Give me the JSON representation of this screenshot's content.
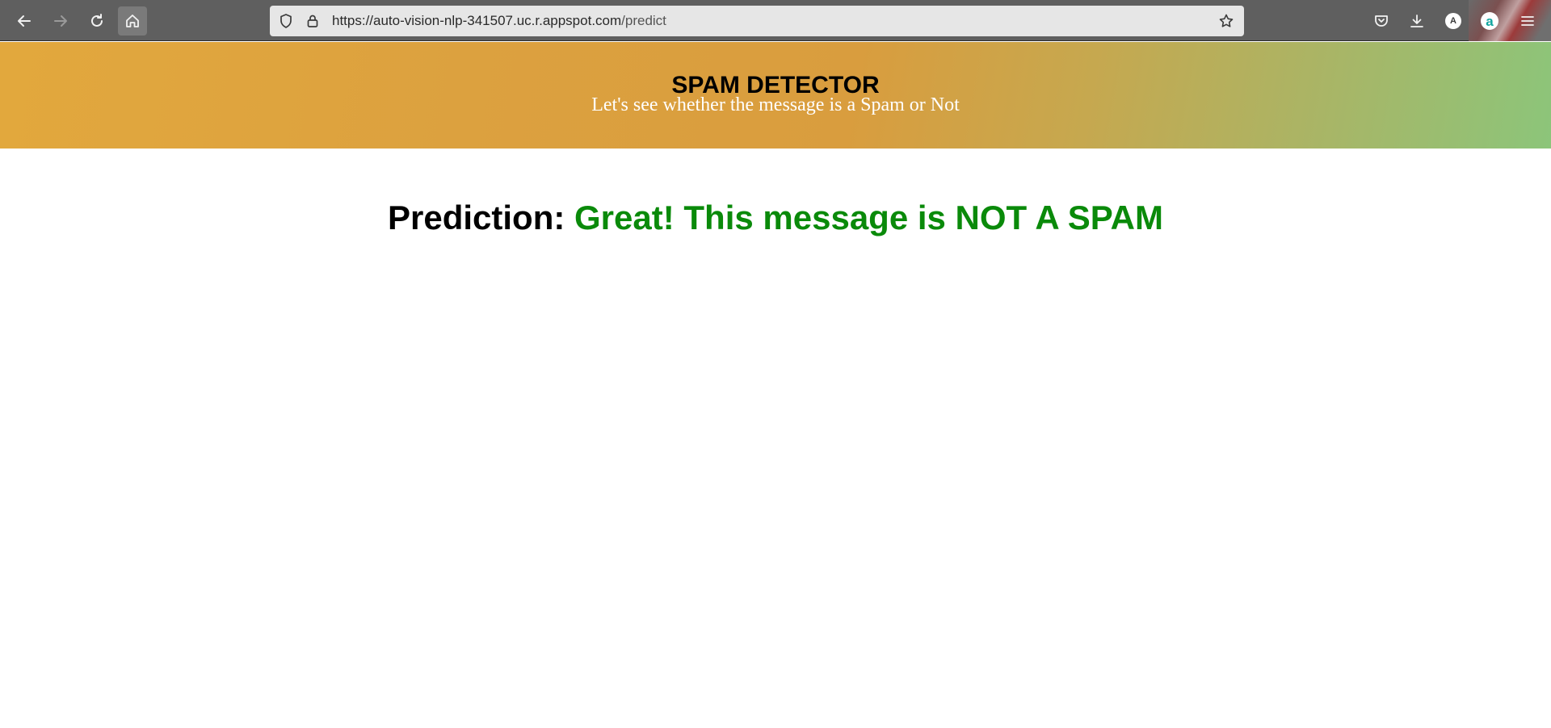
{
  "browser": {
    "url_host": "https://auto-vision-nlp-341507.uc.r.appspot.com",
    "url_path": "/predict",
    "profile_initial": "A",
    "extension_initial": "a"
  },
  "icons": {
    "back": "arrow-left-icon",
    "forward": "arrow-right-icon",
    "reload": "reload-icon",
    "home": "home-icon",
    "tracking": "shield-icon",
    "lock": "lock-icon",
    "bookmark": "star-icon",
    "pocket": "pocket-icon",
    "downloads": "download-icon",
    "menu": "hamburger-menu-icon"
  },
  "header": {
    "title": "SPAM DETECTOR",
    "subtitle": "Let's see whether the message is a Spam or Not"
  },
  "main": {
    "prediction_label": "Prediction:",
    "prediction_result": "Great! This message is NOT A SPAM"
  },
  "colors": {
    "banner_start": "#e2a83d",
    "banner_end": "#8cc57a",
    "result_green": "#0a8a0a"
  }
}
